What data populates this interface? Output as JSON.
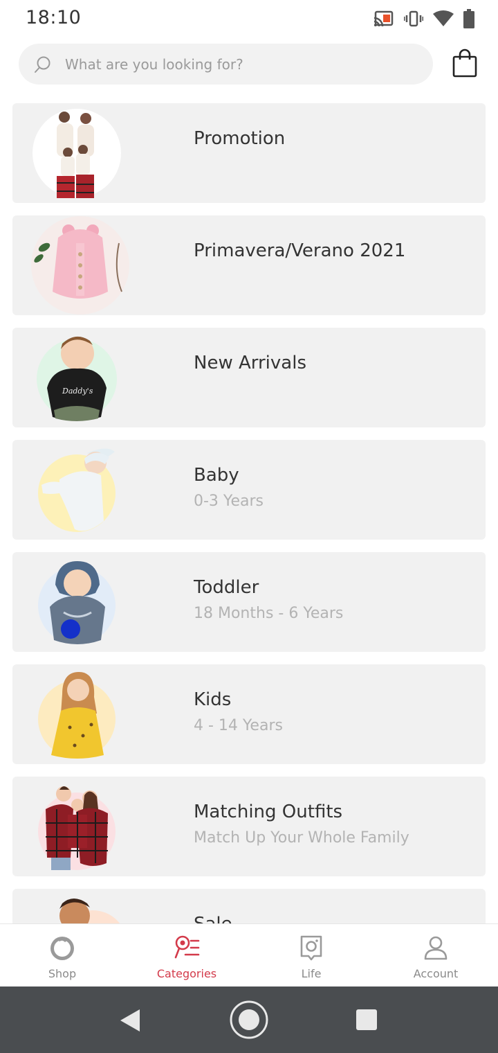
{
  "status_bar": {
    "time": "18:10",
    "icons": [
      "cast-icon",
      "vibrate-icon",
      "wifi-icon",
      "battery-icon"
    ]
  },
  "search": {
    "placeholder": "What are you looking for?"
  },
  "categories": [
    {
      "title": "Promotion",
      "subtitle": ""
    },
    {
      "title": "Primavera/Verano 2021",
      "subtitle": ""
    },
    {
      "title": "New Arrivals",
      "subtitle": ""
    },
    {
      "title": "Baby",
      "subtitle": "0-3 Years"
    },
    {
      "title": "Toddler",
      "subtitle": "18 Months - 6 Years"
    },
    {
      "title": "Kids",
      "subtitle": "4 - 14 Years"
    },
    {
      "title": "Matching Outfits",
      "subtitle": "Match Up Your Whole Family"
    },
    {
      "title": "Sale",
      "subtitle": ""
    }
  ],
  "bottom_nav": [
    {
      "label": "Shop",
      "icon": "shop-icon",
      "active": false
    },
    {
      "label": "Categories",
      "icon": "categories-icon",
      "active": true
    },
    {
      "label": "Life",
      "icon": "life-icon",
      "active": false
    },
    {
      "label": "Account",
      "icon": "account-icon",
      "active": false
    }
  ],
  "colors": {
    "accent": "#d33a4a",
    "card_bg": "#f1f1f1",
    "muted_text": "#b3b3b3",
    "system_nav_bg": "#4a4d50"
  }
}
